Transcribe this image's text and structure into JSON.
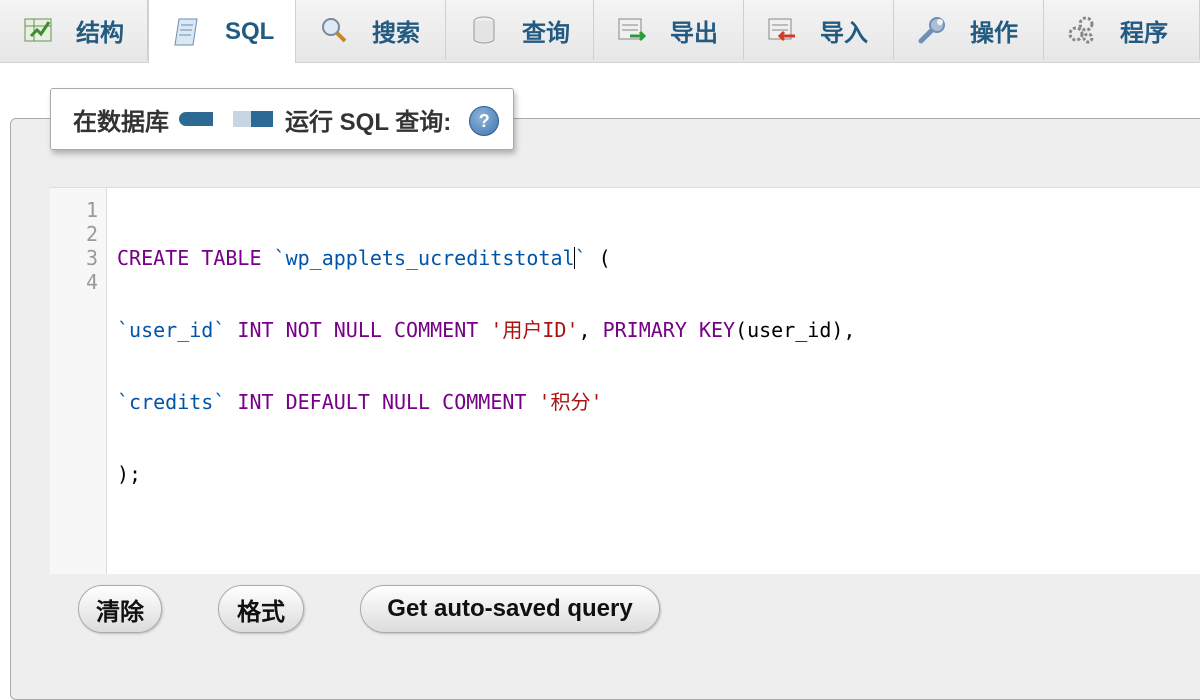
{
  "tabs": [
    {
      "label": "结构",
      "icon": "structure-icon"
    },
    {
      "label": "SQL",
      "icon": "sql-icon",
      "active": true
    },
    {
      "label": "搜索",
      "icon": "search-icon"
    },
    {
      "label": "查询",
      "icon": "query-icon"
    },
    {
      "label": "导出",
      "icon": "export-icon"
    },
    {
      "label": "导入",
      "icon": "import-icon"
    },
    {
      "label": "操作",
      "icon": "wrench-icon"
    },
    {
      "label": "程序",
      "icon": "routines-icon"
    }
  ],
  "legend": {
    "prefix": "在数据库",
    "suffix": "运行 SQL 查询:",
    "help_icon": "help-icon"
  },
  "editor": {
    "line_numbers": [
      "1",
      "2",
      "3",
      "4"
    ],
    "lines": [
      "CREATE TABLE `wp_applets_ucreditstotal` (",
      "`user_id` INT NOT NULL COMMENT '用户ID', PRIMARY KEY(user_id),",
      "`credits` INT DEFAULT NULL COMMENT '积分'",
      ");"
    ]
  },
  "buttons": {
    "clear": "清除",
    "format": "格式",
    "autosaved": "Get auto-saved query"
  },
  "colors": {
    "keyword": "#770088",
    "identifier": "#0055aa",
    "string": "#aa1111",
    "tab_text": "#235a81"
  }
}
